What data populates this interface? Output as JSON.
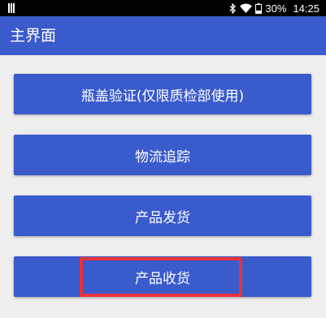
{
  "status_bar": {
    "battery_percent": "30%",
    "time": "14:25",
    "icons": [
      "notification-icon",
      "bluetooth-icon",
      "wifi-icon",
      "battery-icon"
    ]
  },
  "app_bar": {
    "title": "主界面"
  },
  "buttons": [
    {
      "label": "瓶盖验证(仅限质检部使用)"
    },
    {
      "label": "物流追踪"
    },
    {
      "label": "产品发货"
    },
    {
      "label": "产品收货"
    }
  ],
  "colors": {
    "primary": "#3a5bcc",
    "background": "#eeeeee",
    "highlight": "#e8333a"
  }
}
